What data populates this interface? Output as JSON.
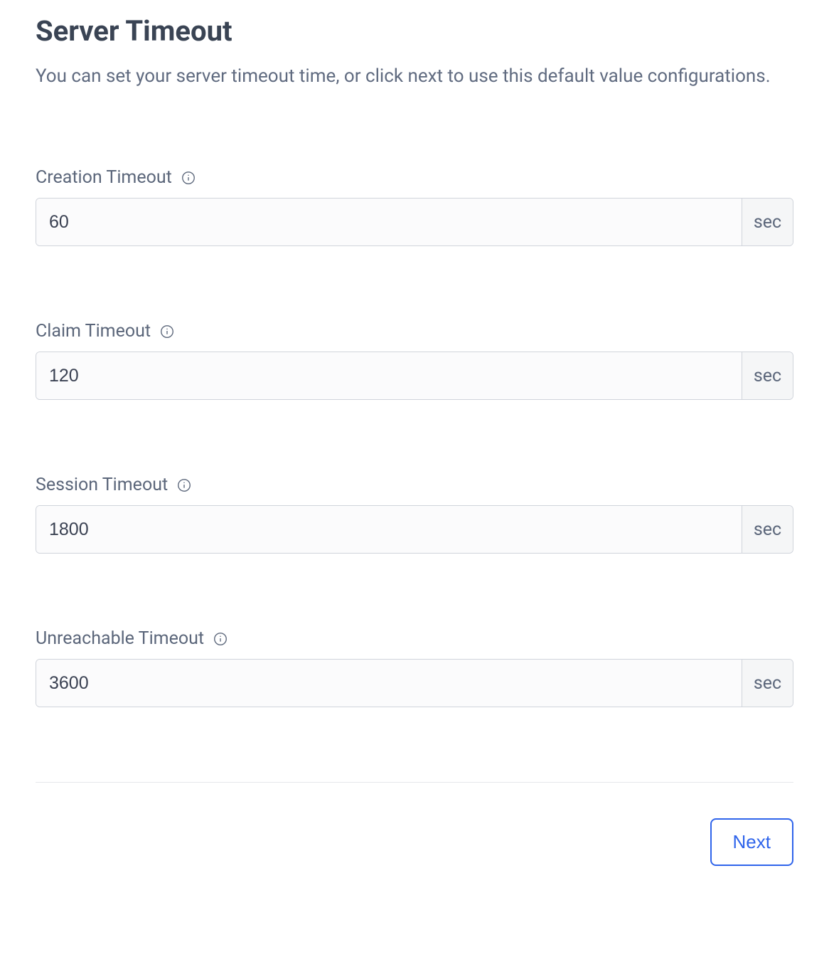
{
  "header": {
    "title": "Server Timeout",
    "description": "You can set your server timeout time, or click next to use this default value configurations."
  },
  "fields": {
    "creation": {
      "label": "Creation Timeout",
      "value": "60",
      "unit": "sec"
    },
    "claim": {
      "label": "Claim Timeout",
      "value": "120",
      "unit": "sec"
    },
    "session": {
      "label": "Session Timeout",
      "value": "1800",
      "unit": "sec"
    },
    "unreachable": {
      "label": "Unreachable Timeout",
      "value": "3600",
      "unit": "sec"
    }
  },
  "footer": {
    "next_label": "Next"
  }
}
